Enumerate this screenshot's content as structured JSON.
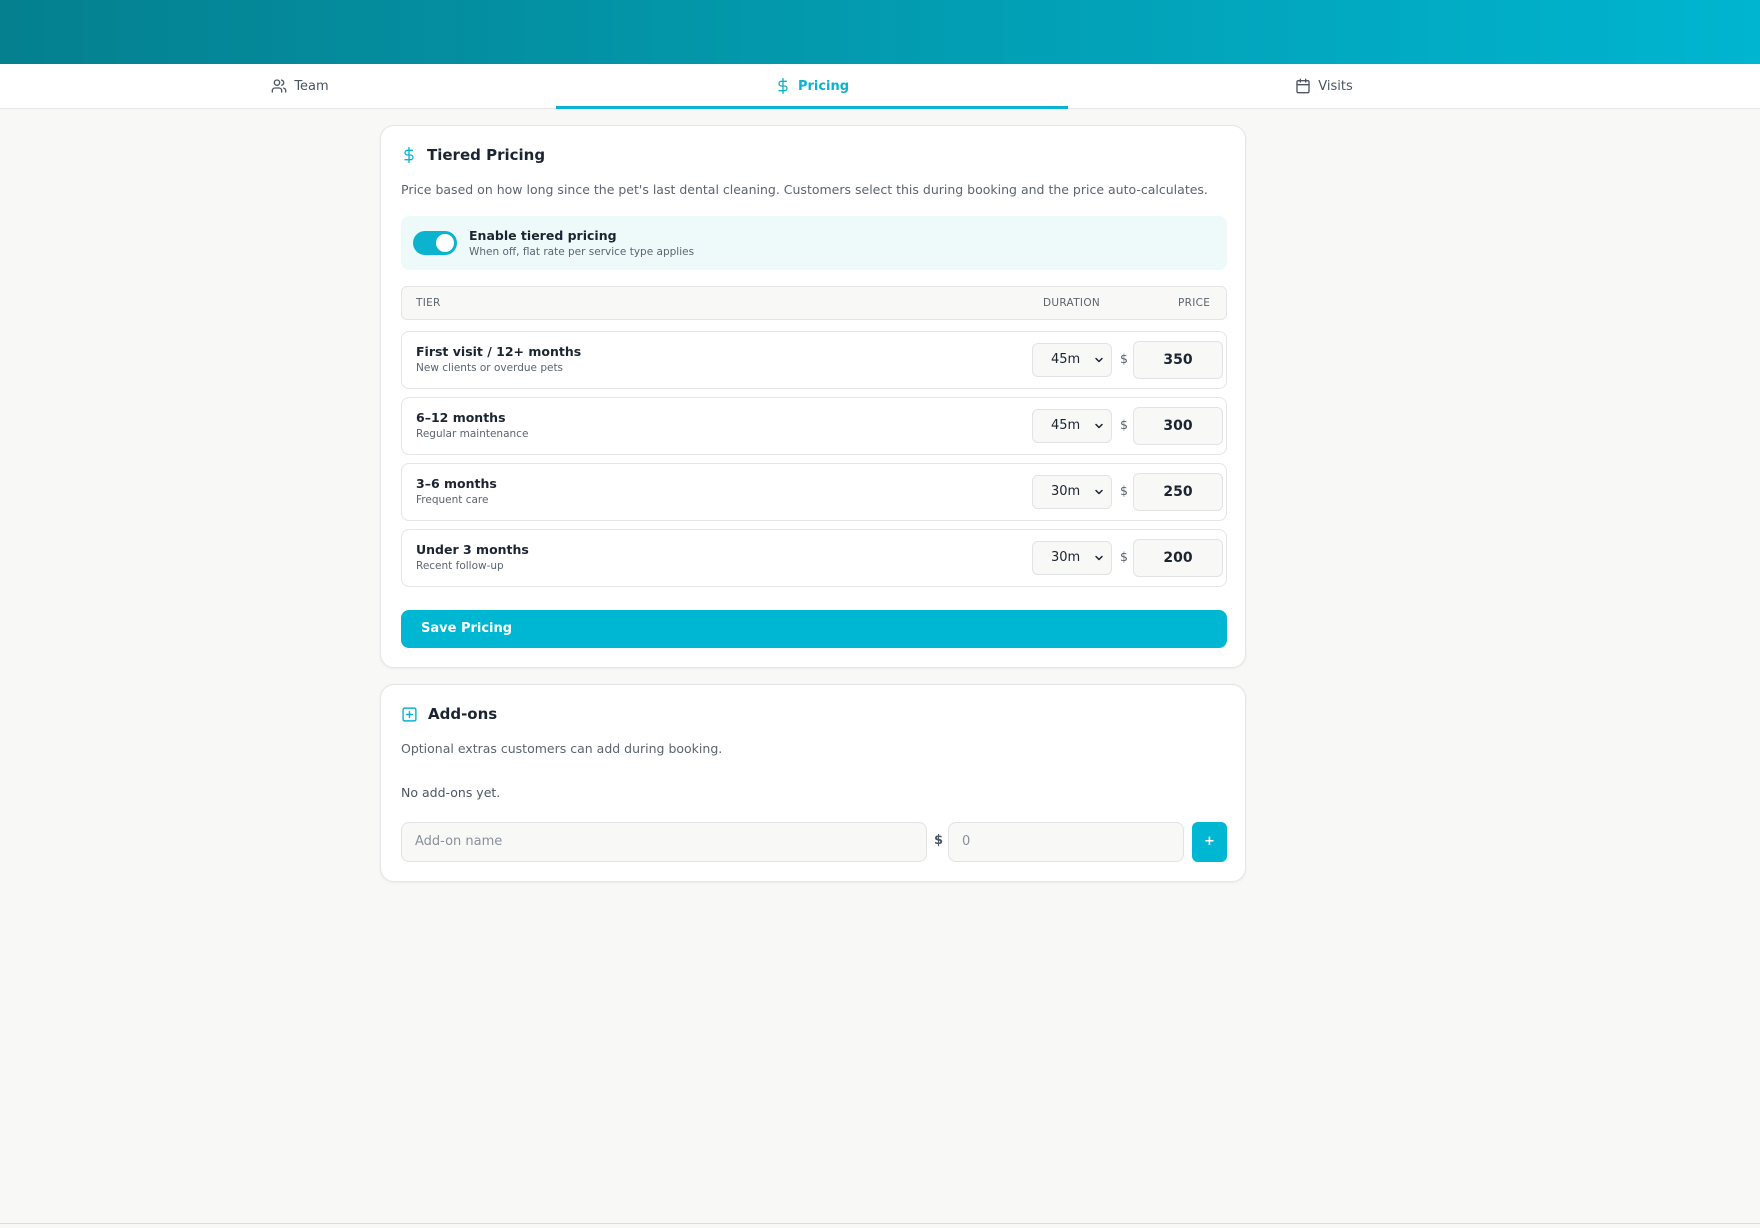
{
  "tabs": [
    {
      "label": "Team",
      "icon": "users-icon",
      "active": false
    },
    {
      "label": "Pricing",
      "icon": "dollar-icon",
      "active": true
    },
    {
      "label": "Visits",
      "icon": "calendar-icon",
      "active": false
    }
  ],
  "tiered": {
    "title": "Tiered Pricing",
    "description": "Price based on how long since the pet's last dental cleaning. Customers select this during booking and the price auto-calculates.",
    "toggle_label": "Enable tiered pricing",
    "toggle_sub": "When off, flat rate per service type applies",
    "toggle_on": true,
    "columns": {
      "tier": "TIER",
      "duration": "DURATION",
      "price": "PRICE"
    },
    "currency": "$",
    "rows": [
      {
        "name": "First visit / 12+ months",
        "sub": "New clients or overdue pets",
        "duration": "45m",
        "price": "350"
      },
      {
        "name": "6–12 months",
        "sub": "Regular maintenance",
        "duration": "45m",
        "price": "300"
      },
      {
        "name": "3–6 months",
        "sub": "Frequent care",
        "duration": "30m",
        "price": "250"
      },
      {
        "name": "Under 3 months",
        "sub": "Recent follow-up",
        "duration": "30m",
        "price": "200"
      }
    ],
    "save_label": "Save Pricing"
  },
  "addons": {
    "title": "Add-ons",
    "description": "Optional extras customers can add during booking.",
    "empty": "No add-ons yet.",
    "name_placeholder": "Add-on name",
    "currency": "$",
    "price_placeholder": "0",
    "add_label": "+"
  },
  "colors": {
    "accent": "#00b7d3",
    "header_start": "#04808f",
    "header_end": "#00b5d0"
  }
}
